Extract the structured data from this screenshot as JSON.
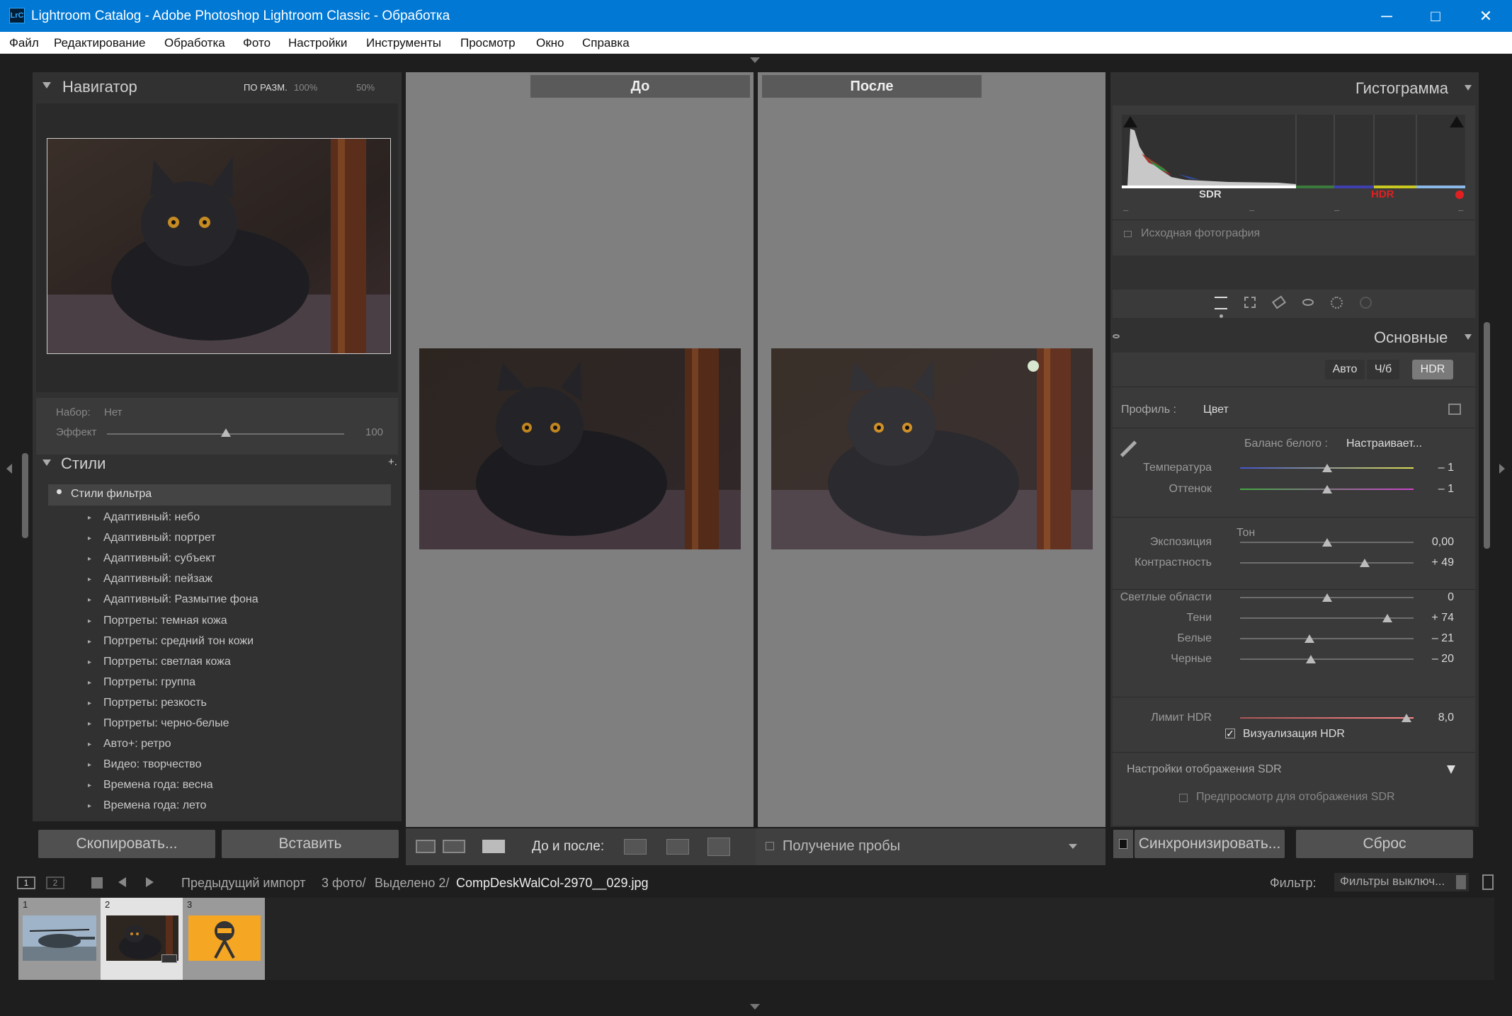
{
  "window": {
    "title": "Lightroom Catalog - Adobe Photoshop Lightroom Classic - Обработка",
    "logo": "LrC",
    "minimize_icon": "─",
    "maximize_icon": "□",
    "close_icon": "✕"
  },
  "menu": [
    "Файл",
    "Редактирование",
    "Обработка",
    "Фото",
    "Настройки",
    "Инструменты",
    "Просмотр",
    "Окно",
    "Справка"
  ],
  "navigator": {
    "title": "Навигатор",
    "zoom": [
      "ПО РАЗМ.",
      "100%",
      "50%"
    ]
  },
  "preset": {
    "set_label": "Набор:",
    "set_value": "Нет",
    "effect_label": "Эффект",
    "effect_value": "100",
    "effect_level": 0.5
  },
  "styles": {
    "title": "Стили",
    "filter_label": "Стили фильтра",
    "add_icon": "+.",
    "items": [
      "Адаптивный: небо",
      "Адаптивный: портрет",
      "Адаптивный: субъект",
      "Адаптивный: пейзаж",
      "Адаптивный: Размытие фона",
      "Портреты: темная кожа",
      "Портреты: средний тон кожи",
      "Портреты: светлая кожа",
      "Портреты: группа",
      "Портреты: резкость",
      "Портреты: черно-белые",
      "Авто+: ретро",
      "Видео: творчество",
      "Времена года: весна",
      "Времена года: лето"
    ]
  },
  "left_buttons": {
    "copy": "Скопировать...",
    "paste": "Вставить"
  },
  "compare": {
    "before": "До",
    "after": "После"
  },
  "toolbar": {
    "before_after_label": "До и после:",
    "sampling_label": "Получение пробы"
  },
  "histogram": {
    "title": "Гистограмма",
    "sdr": "SDR",
    "hdr": "HDR",
    "dashes": [
      "–",
      "–",
      "–",
      "–"
    ],
    "original_label": "Исходная фотография"
  },
  "basic": {
    "title": "Основные",
    "modes": [
      "Авто",
      "Ч/б",
      "HDR"
    ],
    "profile_label": "Профиль :",
    "profile_value": "Цвет",
    "wb_label": "Баланс белого :",
    "wb_value": "Настраивает...",
    "tone_header": "Тон",
    "sliders": [
      {
        "label": "Температура",
        "value": "– 1",
        "level": 0.5
      },
      {
        "label": "Оттенок",
        "value": "– 1",
        "level": 0.5
      },
      {
        "label": "Экспозиция",
        "value": "0,00",
        "level": 0.5
      },
      {
        "label": "Контрастность",
        "value": "+ 49",
        "level": 0.72
      },
      {
        "label": "Светлые области",
        "value": "0",
        "level": 0.5
      },
      {
        "label": "Тени",
        "value": "+ 74",
        "level": 0.85
      },
      {
        "label": "Белые",
        "value": "– 21",
        "level": 0.4
      },
      {
        "label": "Черные",
        "value": "– 20",
        "level": 0.41
      },
      {
        "label": "Лимит HDR",
        "value": "8,0",
        "level": 0.96
      }
    ],
    "hdr_visual_label": "Визуализация HDR",
    "sdr_settings_label": "Настройки отображения SDR",
    "sdr_preview_label": "Предпросмотр для отображения SDR"
  },
  "right_buttons": {
    "sync": "Синхронизировать...",
    "reset": "Сброс"
  },
  "filmstrip": {
    "breadcrumb": "Предыдущий импорт",
    "count": "3 фото/",
    "selected": "Выделено 2/",
    "filename": "CompDeskWalCol-2970__029.jpg",
    "filter_label": "Фильтр:",
    "filter_value": "Фильтры выключ...",
    "views": [
      "1",
      "2"
    ],
    "thumbs": [
      "1",
      "2",
      "3"
    ]
  }
}
